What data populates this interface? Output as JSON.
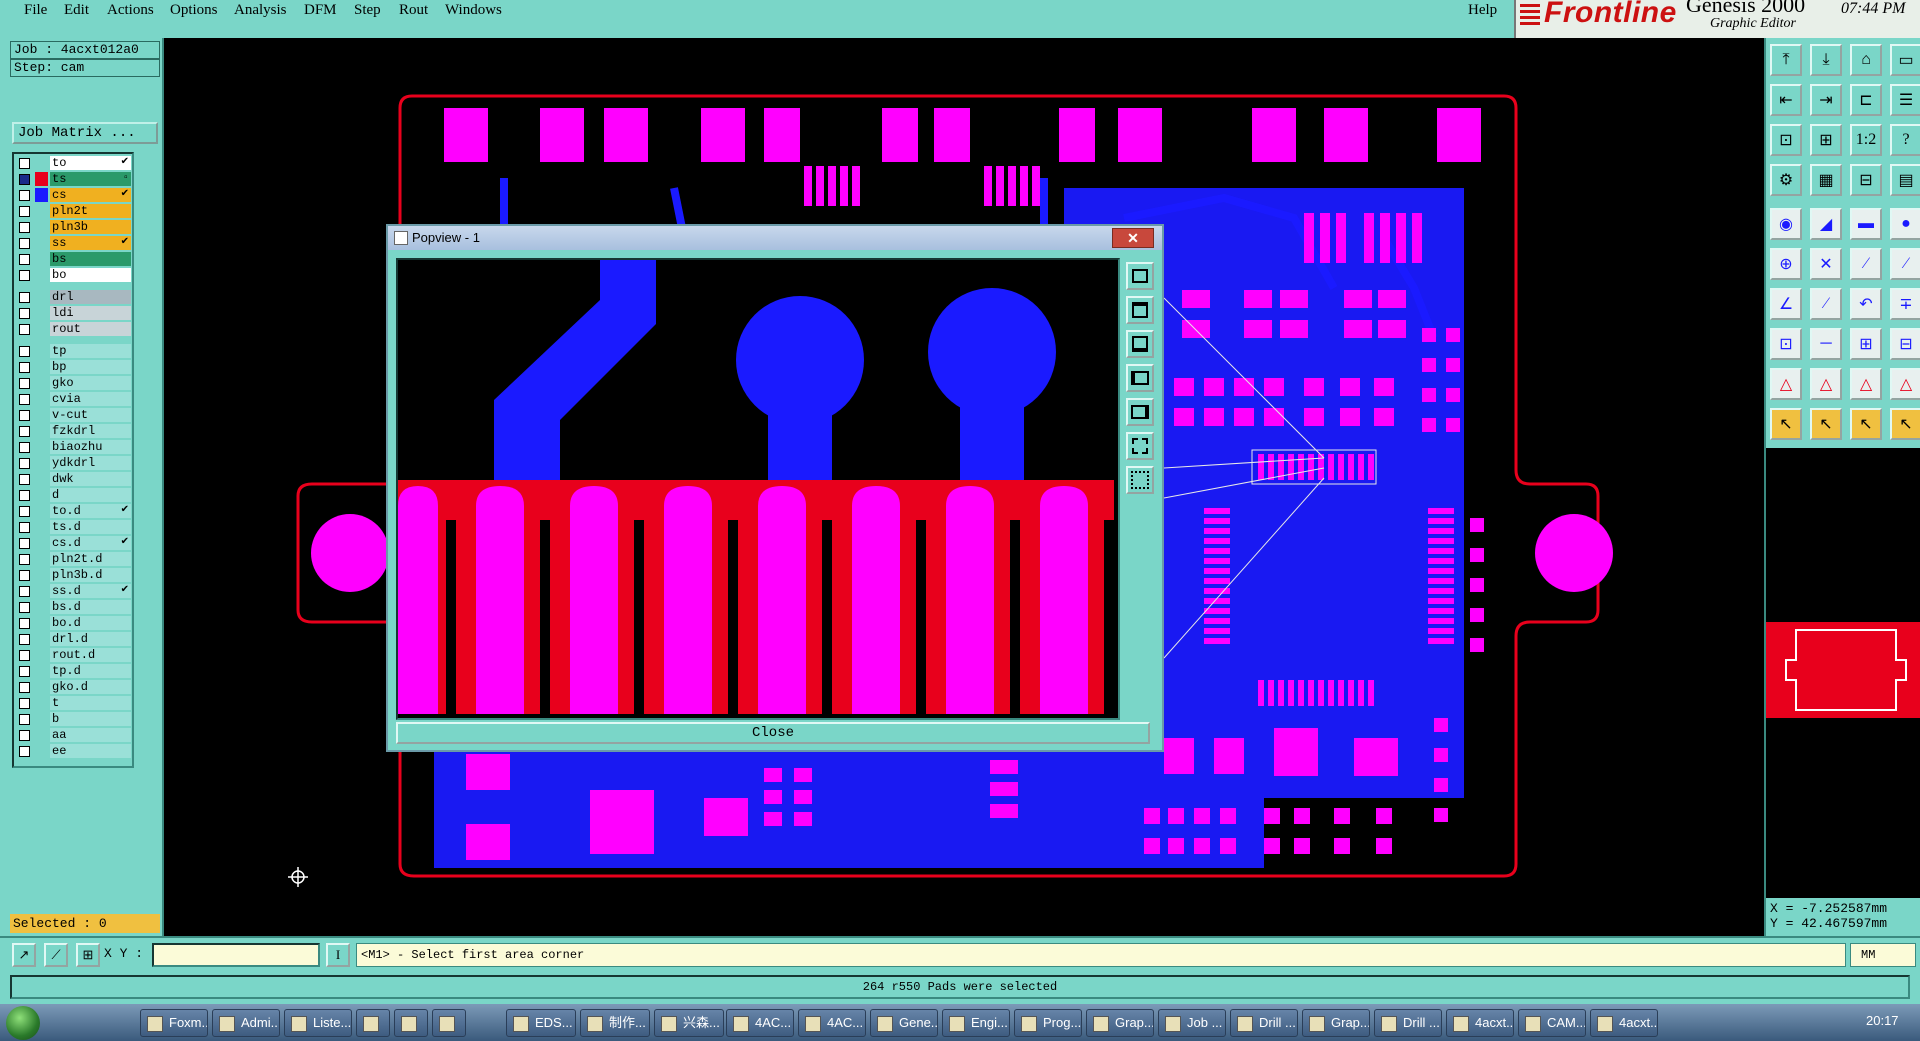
{
  "menu": {
    "items": [
      "File",
      "Edit",
      "Actions",
      "Options",
      "Analysis",
      "DFM",
      "Step",
      "Rout",
      "Windows"
    ],
    "help": "Help"
  },
  "brand": {
    "logo": "Frontline",
    "product": "Genesis 2000",
    "subtitle": "Graphic Editor",
    "time": "07:44 PM"
  },
  "job": {
    "job_label": "Job : 4acxt012a0",
    "step_label": "Step: cam",
    "matrix_button": "Job Matrix ..."
  },
  "layers": [
    {
      "name": "to",
      "color": "#ffffff",
      "selected": false,
      "mark": "✔"
    },
    {
      "name": "ts",
      "color": "#2a9a6a",
      "swatch": "#e8001c",
      "selected": true,
      "mark": "▫"
    },
    {
      "name": "cs",
      "color": "#f0b020",
      "swatch": "#1a1aff",
      "selected": false,
      "mark": "✔"
    },
    {
      "name": "pln2t",
      "color": "#f0b020",
      "selected": false,
      "mark": ""
    },
    {
      "name": "pln3b",
      "color": "#f0b020",
      "selected": false,
      "mark": ""
    },
    {
      "name": "ss",
      "color": "#f0b020",
      "selected": false,
      "mark": "✔"
    },
    {
      "name": "bs",
      "color": "#2a9a6a",
      "selected": false,
      "mark": ""
    },
    {
      "name": "bo",
      "color": "#ffffff",
      "selected": false,
      "mark": ""
    },
    {
      "name": "drl",
      "color": "#a8b8c0",
      "selected": false,
      "mark": ""
    },
    {
      "name": "ldi",
      "color": "#c8d4d8",
      "selected": false,
      "mark": ""
    },
    {
      "name": "rout",
      "color": "#c8d4d8",
      "selected": false,
      "mark": ""
    },
    {
      "name": "tp",
      "color": "#9ae0d8",
      "selected": false,
      "mark": ""
    },
    {
      "name": "bp",
      "color": "#9ae0d8",
      "selected": false,
      "mark": ""
    },
    {
      "name": "gko",
      "color": "#9ae0d8",
      "selected": false,
      "mark": ""
    },
    {
      "name": "cvia",
      "color": "#9ae0d8",
      "selected": false,
      "mark": ""
    },
    {
      "name": "v-cut",
      "color": "#9ae0d8",
      "selected": false,
      "mark": ""
    },
    {
      "name": "fzkdrl",
      "color": "#9ae0d8",
      "selected": false,
      "mark": ""
    },
    {
      "name": "biaozhu",
      "color": "#9ae0d8",
      "selected": false,
      "mark": ""
    },
    {
      "name": "ydkdrl",
      "color": "#9ae0d8",
      "selected": false,
      "mark": ""
    },
    {
      "name": "dwk",
      "color": "#9ae0d8",
      "selected": false,
      "mark": ""
    },
    {
      "name": "d",
      "color": "#9ae0d8",
      "selected": false,
      "mark": ""
    },
    {
      "name": "to.d",
      "color": "#9ae0d8",
      "selected": false,
      "mark": "✔"
    },
    {
      "name": "ts.d",
      "color": "#9ae0d8",
      "selected": false,
      "mark": ""
    },
    {
      "name": "cs.d",
      "color": "#9ae0d8",
      "selected": false,
      "mark": "✔"
    },
    {
      "name": "pln2t.d",
      "color": "#9ae0d8",
      "selected": false,
      "mark": ""
    },
    {
      "name": "pln3b.d",
      "color": "#9ae0d8",
      "selected": false,
      "mark": ""
    },
    {
      "name": "ss.d",
      "color": "#9ae0d8",
      "selected": false,
      "mark": "✔"
    },
    {
      "name": "bs.d",
      "color": "#9ae0d8",
      "selected": false,
      "mark": ""
    },
    {
      "name": "bo.d",
      "color": "#9ae0d8",
      "selected": false,
      "mark": ""
    },
    {
      "name": "drl.d",
      "color": "#9ae0d8",
      "selected": false,
      "mark": ""
    },
    {
      "name": "rout.d",
      "color": "#9ae0d8",
      "selected": false,
      "mark": ""
    },
    {
      "name": "tp.d",
      "color": "#9ae0d8",
      "selected": false,
      "mark": ""
    },
    {
      "name": "gko.d",
      "color": "#9ae0d8",
      "selected": false,
      "mark": ""
    },
    {
      "name": "t",
      "color": "#9ae0d8",
      "selected": false,
      "mark": ""
    },
    {
      "name": "b",
      "color": "#9ae0d8",
      "selected": false,
      "mark": ""
    },
    {
      "name": "aa",
      "color": "#9ae0d8",
      "selected": false,
      "mark": ""
    },
    {
      "name": "ee",
      "color": "#9ae0d8",
      "selected": false,
      "mark": ""
    }
  ],
  "selected_label": "Selected : 0",
  "popview": {
    "title": "Popview - 1",
    "close_x": "✕",
    "close_button": "Close"
  },
  "coords": {
    "x": "X = -7.252587mm",
    "y": "Y = 42.467597mm"
  },
  "command": {
    "xy_label": "X Y :",
    "xy_value": "",
    "prompt": "<M1> - Select first area corner",
    "unit": "MM"
  },
  "status": "264 r550 Pads were selected",
  "taskbar": {
    "items": [
      "Foxm...",
      "Admi...",
      "Liste...",
      "",
      "",
      "",
      "EDS...",
      "制作...",
      "兴森...",
      "4AC...",
      "4AC...",
      "Gene...",
      "Engi...",
      "Prog...",
      "Grap...",
      "Job ...",
      "Drill ...",
      "Grap...",
      "Drill ...",
      "4acxt...",
      "CAM...",
      "4acxt..."
    ],
    "clock": "20:17"
  },
  "colors": {
    "panel": "#7ad6c8",
    "pad_top": "#ff00ff",
    "copper": "#1a1aff",
    "outline": "#e8001c",
    "highlight": "#f0c040"
  }
}
